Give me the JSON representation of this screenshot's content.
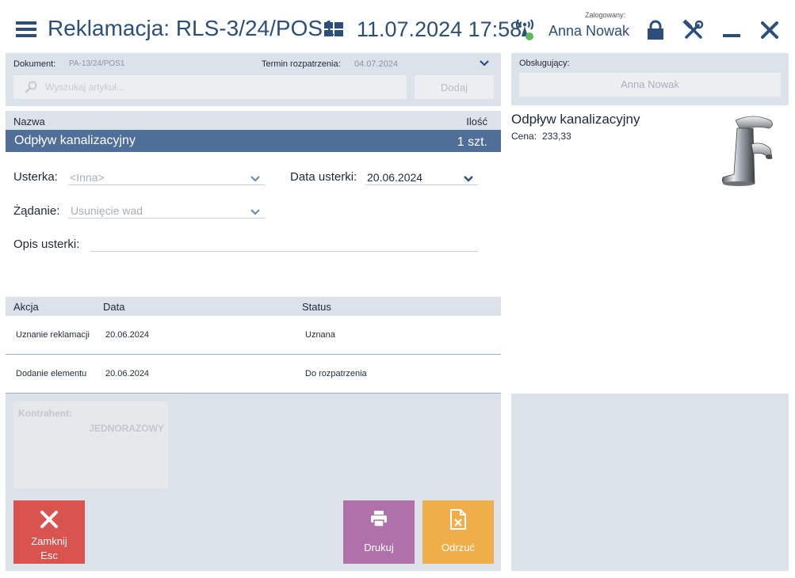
{
  "header": {
    "title": "Reklamacja: RLS-3/24/POS1",
    "datetime": "11.07.2024 17:58",
    "logged_label": "Zalogowany:",
    "logged_user": "Anna Nowak"
  },
  "document": {
    "doc_label": "Dokument:",
    "doc_value": "PA-13/24/POS1",
    "term_label": "Termin rozpatrzenia:",
    "term_value": "04.07.2024",
    "search_placeholder": "Wyszukaj artykuł...",
    "add_label": "Dodaj"
  },
  "items": {
    "columns": {
      "name": "Nazwa",
      "qty": "Ilość"
    },
    "rows": [
      {
        "name": "Odpływ kanalizacyjny",
        "qty": "1 szt."
      }
    ]
  },
  "form": {
    "defect_label": "Usterka:",
    "defect_value": "<Inna>",
    "defect_date_label": "Data usterki:",
    "defect_date_value": "20.06.2024",
    "request_label": "Żądanie:",
    "request_value": "Usunięcie wad",
    "description_label": "Opis usterki:",
    "description_value": ""
  },
  "actions": {
    "columns": {
      "action": "Akcja",
      "date": "Data",
      "status": "Status"
    },
    "rows": [
      {
        "action": "Uznanie reklamacji",
        "date": "20.06.2024",
        "status": "Uznana"
      },
      {
        "action": "Dodanie elementu",
        "date": "20.06.2024",
        "status": "Do rozpatrzenia"
      }
    ]
  },
  "contractor": {
    "label": "Kontrahent:",
    "value": "JEDNORAZOWY"
  },
  "buttons": {
    "close": "Zamknij",
    "close_shortcut": "Esc",
    "print": "Drukuj",
    "reject": "Odrzuć"
  },
  "attendant": {
    "label": "Obsługujący:",
    "value": "Anna Nowak"
  },
  "product": {
    "name": "Odpływ kanalizacyjny",
    "price_label": "Cena:",
    "price": "233,33",
    "image_icon": "faucet-icon"
  },
  "colors": {
    "brand": "#2b4f7a",
    "selected_row": "#4f6e98",
    "panel": "#dbe2ea",
    "close_button": "#d9534f",
    "print_button": "#b070a9",
    "reject_button": "#efae4a",
    "status_online": "#5cb85c"
  }
}
